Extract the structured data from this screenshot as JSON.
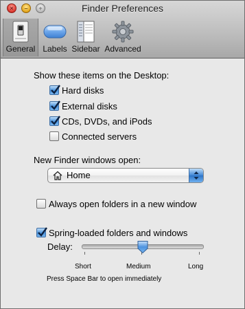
{
  "window": {
    "title": "Finder Preferences"
  },
  "toolbar": {
    "items": [
      {
        "label": "General",
        "icon": "switch-icon",
        "selected": true
      },
      {
        "label": "Labels",
        "icon": "label-pill-icon"
      },
      {
        "label": "Sidebar",
        "icon": "sidebar-list-icon"
      },
      {
        "label": "Advanced",
        "icon": "gear-icon"
      }
    ]
  },
  "desktop": {
    "heading": "Show these items on the Desktop:",
    "items": [
      {
        "label": "Hard disks",
        "checked": true
      },
      {
        "label": "External disks",
        "checked": true
      },
      {
        "label": "CDs, DVDs, and iPods",
        "checked": true
      },
      {
        "label": "Connected servers",
        "checked": false
      }
    ]
  },
  "new_window": {
    "heading": "New Finder windows open:",
    "selected": "Home",
    "icon": "home-icon"
  },
  "always_open": {
    "label": "Always open folders in a new window",
    "checked": false
  },
  "spring": {
    "label": "Spring-loaded folders and windows",
    "checked": true,
    "delay_label": "Delay:",
    "short_label": "Short",
    "medium_label": "Medium",
    "long_label": "Long",
    "delay_value": 0.5,
    "hint": "Press Space Bar to open immediately"
  },
  "colors": {
    "accent": "#3f86d6",
    "window_bg": "#e8e8e8",
    "toolbar_bg": "#b5b5b5"
  }
}
